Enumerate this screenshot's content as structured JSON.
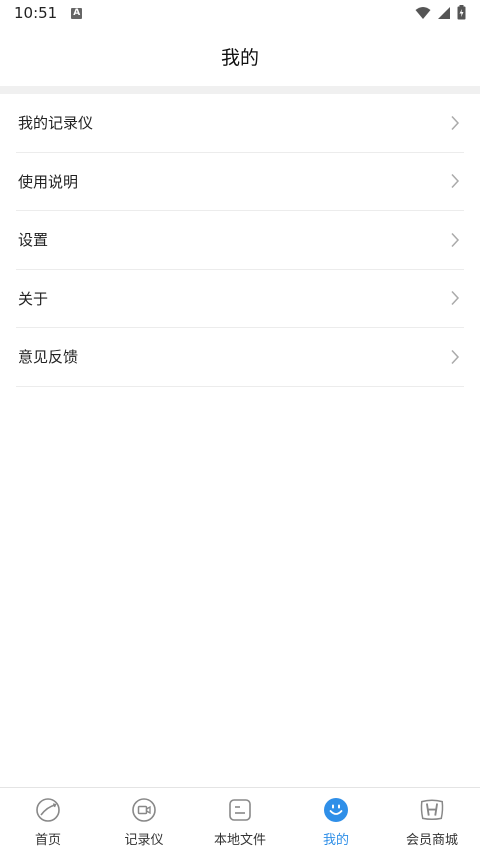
{
  "status_bar": {
    "time": "10:51",
    "notification_letter": "A"
  },
  "header": {
    "title": "我的"
  },
  "menu": {
    "items": [
      {
        "label": "我的记录仪"
      },
      {
        "label": "使用说明"
      },
      {
        "label": "设置"
      },
      {
        "label": "关于"
      },
      {
        "label": "意见反馈"
      }
    ]
  },
  "tab_bar": {
    "active_color": "#2f8fe8",
    "items": [
      {
        "label": "首页",
        "icon": "compass-icon"
      },
      {
        "label": "记录仪",
        "icon": "camera-icon"
      },
      {
        "label": "本地文件",
        "icon": "file-icon"
      },
      {
        "label": "我的",
        "icon": "smiley-icon",
        "active": true
      },
      {
        "label": "会员商城",
        "icon": "honda-logo-icon"
      }
    ]
  }
}
